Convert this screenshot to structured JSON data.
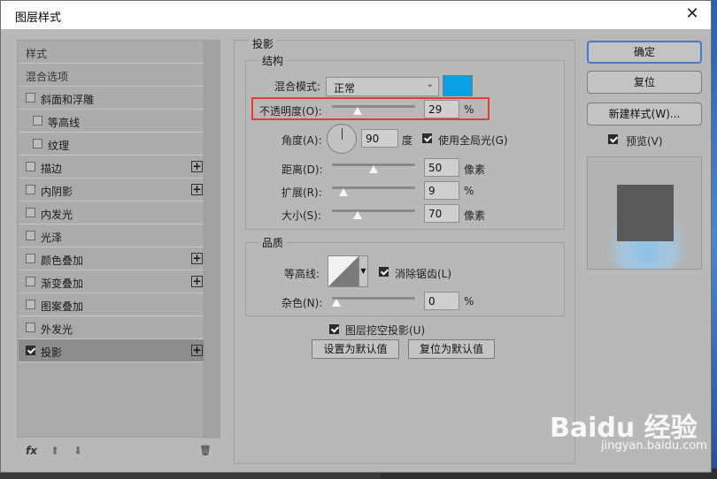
{
  "window": {
    "title": "图层样式",
    "close_glyph": "✕"
  },
  "sidebar": {
    "items": [
      {
        "label": "样式",
        "type": "header"
      },
      {
        "label": "混合选项",
        "type": "header"
      },
      {
        "label": "斜面和浮雕",
        "checked": false,
        "plus": false
      },
      {
        "label": "等高线",
        "checked": false,
        "plus": false,
        "indent": true
      },
      {
        "label": "纹理",
        "checked": false,
        "plus": false,
        "indent": true
      },
      {
        "label": "描边",
        "checked": false,
        "plus": true
      },
      {
        "label": "内阴影",
        "checked": false,
        "plus": true
      },
      {
        "label": "内发光",
        "checked": false,
        "plus": false
      },
      {
        "label": "光泽",
        "checked": false,
        "plus": false
      },
      {
        "label": "颜色叠加",
        "checked": false,
        "plus": true
      },
      {
        "label": "渐变叠加",
        "checked": false,
        "plus": true
      },
      {
        "label": "图案叠加",
        "checked": false,
        "plus": false
      },
      {
        "label": "外发光",
        "checked": false,
        "plus": false
      },
      {
        "label": "投影",
        "checked": true,
        "plus": true,
        "selected": true
      }
    ],
    "plus_glyph": "+",
    "tools": {
      "fx": "fx",
      "up": "⬆",
      "down": "⬇",
      "trash": "🗑"
    }
  },
  "drop_shadow": {
    "section_title": "投影",
    "structure": {
      "title": "结构",
      "blend_mode_label": "混合模式:",
      "blend_mode_value": "正常",
      "shadow_color": "#0aa0e8",
      "opacity_label": "不透明度(O):",
      "opacity_value": "29",
      "opacity_unit": "%",
      "opacity_fraction": 0.29,
      "angle_label": "角度(A):",
      "angle_value": "90",
      "angle_unit": "度",
      "global_light_label": "使用全局光(G)",
      "global_light_checked": true,
      "distance_label": "距离(D):",
      "distance_value": "50",
      "distance_unit": "像素",
      "distance_fraction": 0.5,
      "spread_label": "扩展(R):",
      "spread_value": "9",
      "spread_unit": "%",
      "spread_fraction": 0.09,
      "size_label": "大小(S):",
      "size_value": "70",
      "size_unit": "像素",
      "size_fraction": 0.28
    },
    "quality": {
      "title": "品质",
      "contour_label": "等高线:",
      "antialias_label": "消除锯齿(L)",
      "antialias_checked": true,
      "noise_label": "杂色(N):",
      "noise_value": "0",
      "noise_unit": "%",
      "noise_fraction": 0
    },
    "knockout_label": "图层挖空投影(U)",
    "knockout_checked": true,
    "make_default_label": "设置为默认值",
    "reset_default_label": "复位为默认值"
  },
  "actions": {
    "ok_label": "确定",
    "reset_label": "复位",
    "new_style_label": "新建样式(W)...",
    "preview_label": "预览(V)",
    "preview_checked": true
  },
  "watermark": {
    "brand": "Baidu 经验",
    "url": "jingyan.baidu.com"
  }
}
